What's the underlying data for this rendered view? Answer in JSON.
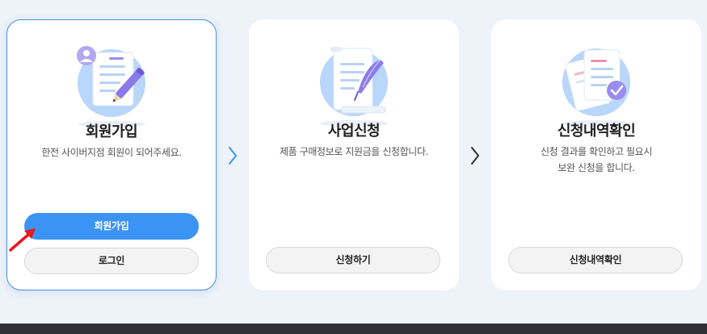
{
  "steps": [
    {
      "title": "회원가입",
      "desc": "한전 사이버지점 회원이 되어주세요.",
      "primary_button": "회원가입",
      "secondary_button": "로그인"
    },
    {
      "title": "사업신청",
      "desc": "제품 구매정보로 지원금을 신청합니다.",
      "button": "신청하기"
    },
    {
      "title": "신청내역확인",
      "desc_line1": "신청 결과를 확인하고 필요시",
      "desc_line2": "보완 신청을 합니다.",
      "button": "신청내역확인"
    }
  ],
  "icons": {
    "step1": "signup-document-pen-icon",
    "step2": "scroll-quill-icon",
    "step3": "documents-check-icon",
    "next": "chevron-right-icon",
    "pointer": "red-arrow-pointer"
  },
  "colors": {
    "accent": "#3b93f5",
    "active_border": "#4a90e2",
    "background": "#eef2f9",
    "footer": "#2f3037"
  }
}
